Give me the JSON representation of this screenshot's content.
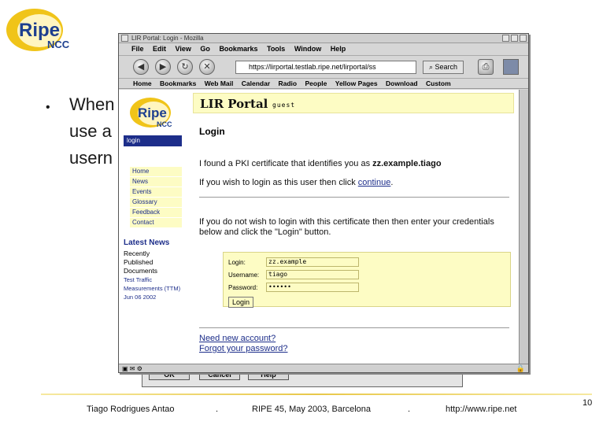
{
  "slide": {
    "bullet_lines": [
      "When",
      "use a",
      "usern"
    ],
    "footer_author": "Tiago Rodrigues Antao",
    "footer_sep1": ".",
    "footer_event": "RIPE 45,  May 2003, Barcelona",
    "footer_sep2": ".",
    "footer_url": "http://www.ripe.net",
    "page_number": "10",
    "logo_ripe": "Ripe",
    "logo_ncc": "NCC"
  },
  "back_dialog": {
    "buttons": [
      "OK",
      "Cancel",
      "Help"
    ]
  },
  "browser": {
    "title": "LIR Portal: Login - Mozilla",
    "menu": [
      "File",
      "Edit",
      "View",
      "Go",
      "Bookmarks",
      "Tools",
      "Window",
      "Help"
    ],
    "url": "https://lirportal.testlab.ripe.net/lirportal/ss",
    "search_label": "Search",
    "bookmarks": [
      "Home",
      "Bookmarks",
      "Web Mail",
      "Calendar",
      "Radio",
      "People",
      "Yellow Pages",
      "Download",
      "Custom"
    ]
  },
  "page": {
    "logo_ripe": "Ripe",
    "logo_ncc": "NCC",
    "portal_title": "LIR Portal",
    "portal_user": "guest",
    "login_tab": "login",
    "nav": [
      "Home",
      "News",
      "Events",
      "Glossary",
      "Feedback",
      "Contact"
    ],
    "latest_title": "Latest News",
    "latest_items": [
      "Recently",
      "Published",
      "Documents"
    ],
    "latest_links": [
      "Test Traffic",
      "Measurements (TTM)",
      "Jun 06 2002"
    ],
    "heading": "Login",
    "cert_text_prefix": "I found a PKI certificate that identifies you as ",
    "cert_user": "zz.example.tiago",
    "continue_prefix": "If you wish to login as this user then click ",
    "continue_link": "continue",
    "continue_suffix": ".",
    "not_text": "If you do not wish to login with this certificate then then enter your credentials below and click the \"Login\" button.",
    "form": {
      "login_label": "Login:",
      "login_value": "zz.example",
      "username_label": "Username:",
      "username_value": "tiago",
      "password_label": "Password:",
      "password_value": "••••••",
      "submit_label": "Login"
    },
    "new_account": "Need new account?",
    "forgot_password": "Forgot your password?"
  }
}
